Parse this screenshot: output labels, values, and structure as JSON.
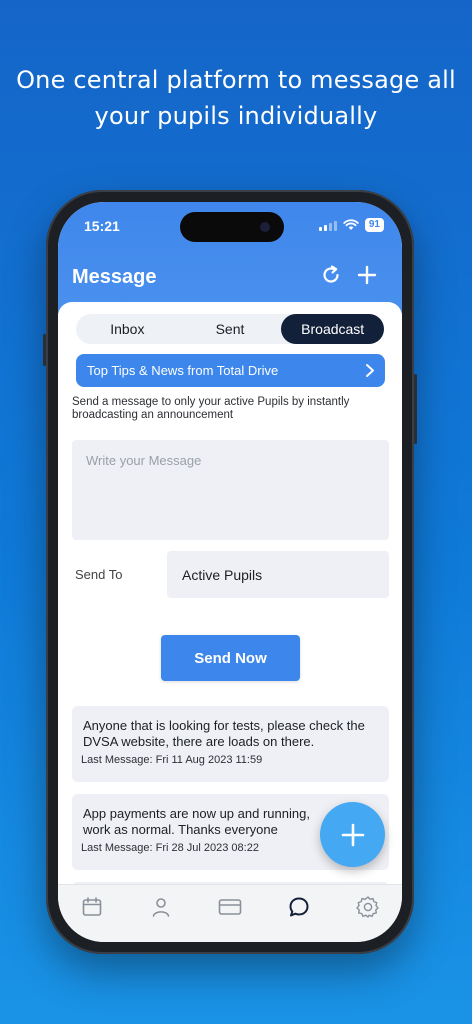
{
  "headline": {
    "line1": "One central platform to message all",
    "line2": "your pupils individually"
  },
  "status_bar": {
    "time": "15:21",
    "battery": "91"
  },
  "header": {
    "title": "Message",
    "refresh_icon": "refresh-icon",
    "add_icon": "plus-icon"
  },
  "tabs": [
    {
      "label": "Inbox",
      "active": false
    },
    {
      "label": "Sent",
      "active": false
    },
    {
      "label": "Broadcast",
      "active": true
    }
  ],
  "tips_banner": {
    "label": "Top Tips & News from Total Drive"
  },
  "description": "Send a message to only your active Pupils by instantly broadcasting an announcement",
  "compose": {
    "placeholder": "Write your Message",
    "value": ""
  },
  "send_to": {
    "label": "Send To",
    "value": "Active Pupils"
  },
  "send_button": "Send Now",
  "messages": [
    {
      "text": "Anyone that is looking for tests, please check the DVSA website, there are loads on there.",
      "date": "Last Message: Fri 11 Aug 2023 11:59"
    },
    {
      "text": "App payments are now up and running, work as normal. Thanks everyone",
      "date": "Last Message: Fri 28 Jul 2023 08:22"
    }
  ],
  "nav": [
    {
      "icon": "calendar-icon",
      "active": false
    },
    {
      "icon": "person-icon",
      "active": false
    },
    {
      "icon": "card-icon",
      "active": false
    },
    {
      "icon": "chat-icon",
      "active": true
    },
    {
      "icon": "gear-icon",
      "active": false
    }
  ],
  "colors": {
    "background": "#1565c8",
    "accent": "#3d87ec",
    "active_tab": "#13203a",
    "fab": "#45a8f2"
  }
}
